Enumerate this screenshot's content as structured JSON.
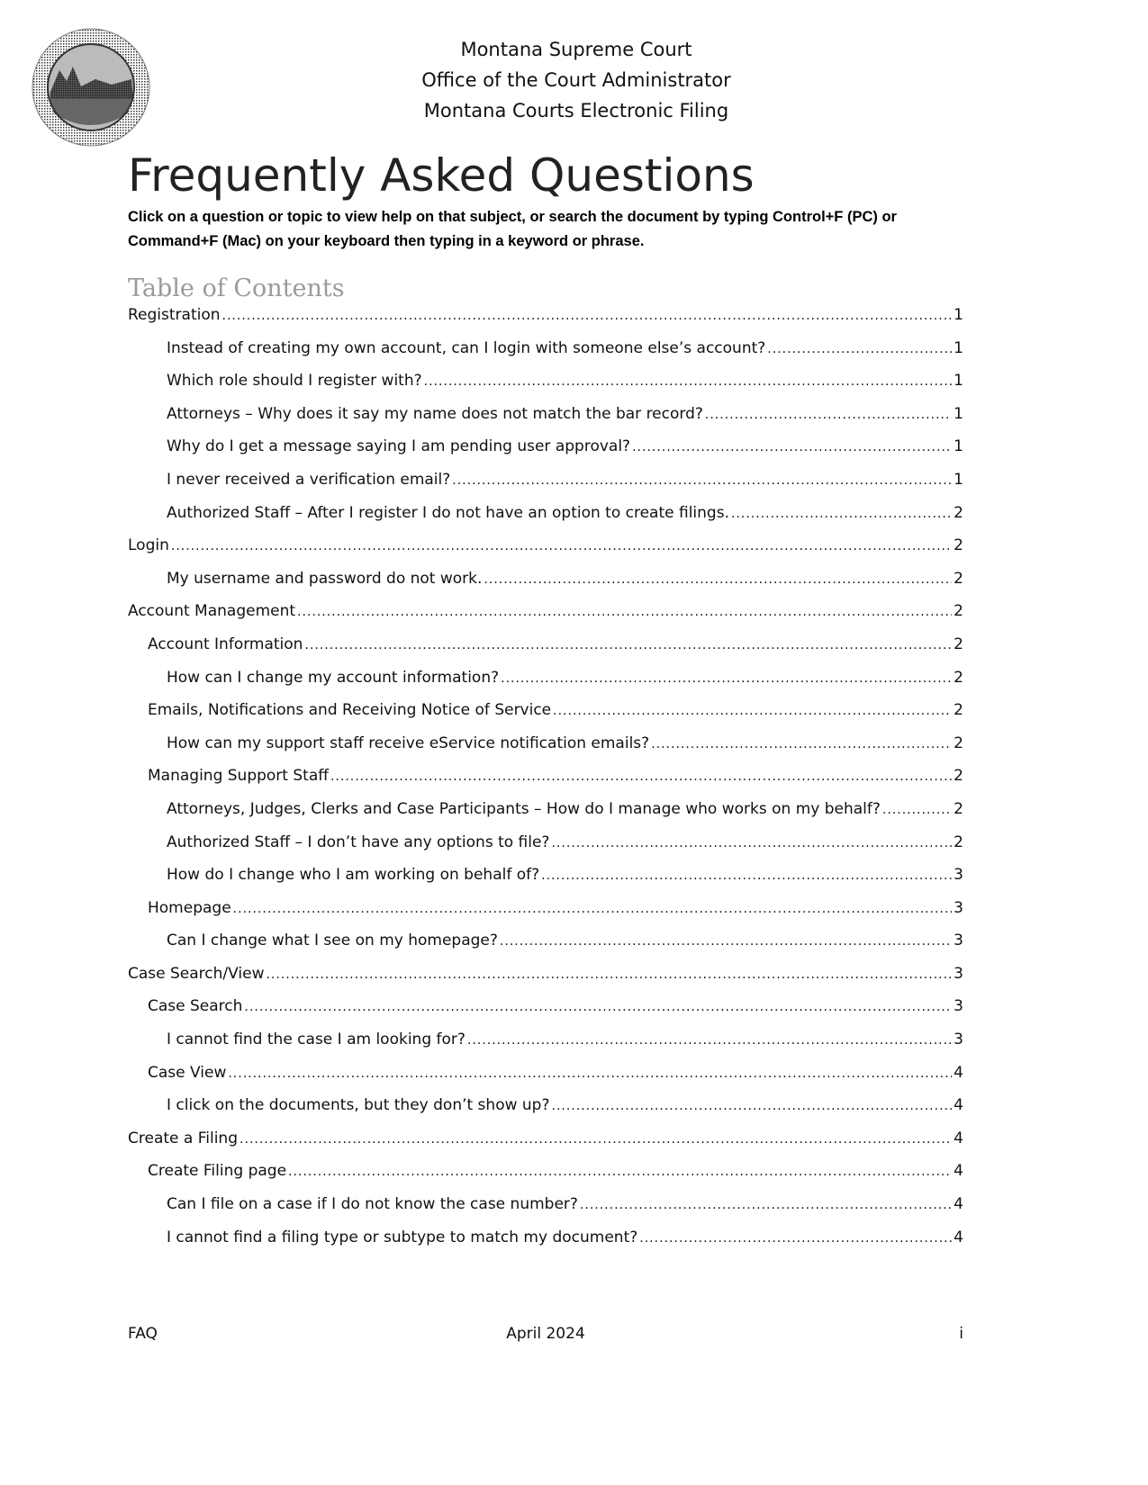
{
  "header": {
    "lines": [
      "Montana Supreme Court",
      "Office of the Court Administrator",
      "Montana Courts Electronic Filing"
    ],
    "logo": "court-seal-icon"
  },
  "title": "Frequently Asked Questions",
  "intro": "Click on a question or topic to view help on that subject, or search the document by typing Control+F (PC) or Command+F (Mac) on your keyboard then typing in a keyword or phrase.",
  "toc": {
    "heading": "Table of Contents",
    "entries": [
      {
        "label": "Registration",
        "page": "1",
        "level": 1
      },
      {
        "label": "Instead of creating my own account, can I login with someone else’s account?",
        "page": "1",
        "level": 3
      },
      {
        "label": "Which role should I register with?",
        "page": "1",
        "level": 3
      },
      {
        "label": "Attorneys – Why does it say my name does not match the bar record?",
        "page": "1",
        "level": 3
      },
      {
        "label": "Why do I get a message saying I am pending user approval?",
        "page": "1",
        "level": 3
      },
      {
        "label": "I never received a verification email?",
        "page": "1",
        "level": 3
      },
      {
        "label": "Authorized Staff – After I register I do not have an option to create filings.",
        "page": "2",
        "level": 3
      },
      {
        "label": "Login",
        "page": "2",
        "level": 1
      },
      {
        "label": "My username and password do not work.",
        "page": "2",
        "level": 3
      },
      {
        "label": "Account Management",
        "page": "2",
        "level": 1
      },
      {
        "label": "Account Information",
        "page": "2",
        "level": 2
      },
      {
        "label": "How can I change my account information?",
        "page": "2",
        "level": 3
      },
      {
        "label": "Emails, Notifications and Receiving Notice of Service",
        "page": "2",
        "level": 2
      },
      {
        "label": "How can my support staff receive eService notification emails?",
        "page": "2",
        "level": 3
      },
      {
        "label": "Managing Support Staff",
        "page": "2",
        "level": 2
      },
      {
        "label": "Attorneys, Judges, Clerks and Case Participants – How do I manage who works on my behalf?",
        "page": "2",
        "level": 3
      },
      {
        "label": "Authorized Staff – I don’t have any options to file?",
        "page": "2",
        "level": 3
      },
      {
        "label": "How do I change who I am working on behalf of?",
        "page": "3",
        "level": 3
      },
      {
        "label": "Homepage",
        "page": "3",
        "level": 2
      },
      {
        "label": "Can I change what I see on my homepage?",
        "page": "3",
        "level": 3
      },
      {
        "label": "Case Search/View",
        "page": "3",
        "level": 1
      },
      {
        "label": "Case Search",
        "page": "3",
        "level": 2
      },
      {
        "label": "I cannot find the case I am looking for?",
        "page": "3",
        "level": 3
      },
      {
        "label": "Case View",
        "page": "4",
        "level": 2
      },
      {
        "label": "I click on the documents, but they don’t show up?",
        "page": "4",
        "level": 3
      },
      {
        "label": "Create a Filing",
        "page": "4",
        "level": 1
      },
      {
        "label": "Create Filing page",
        "page": "4",
        "level": 2
      },
      {
        "label": "Can I file on a case if I do not know the case number?",
        "page": "4",
        "level": 3
      },
      {
        "label": "I cannot find a filing type or subtype to match my document?",
        "page": "4",
        "level": 3
      }
    ]
  },
  "footer": {
    "left": "FAQ",
    "center": "April 2024",
    "right": "i"
  }
}
